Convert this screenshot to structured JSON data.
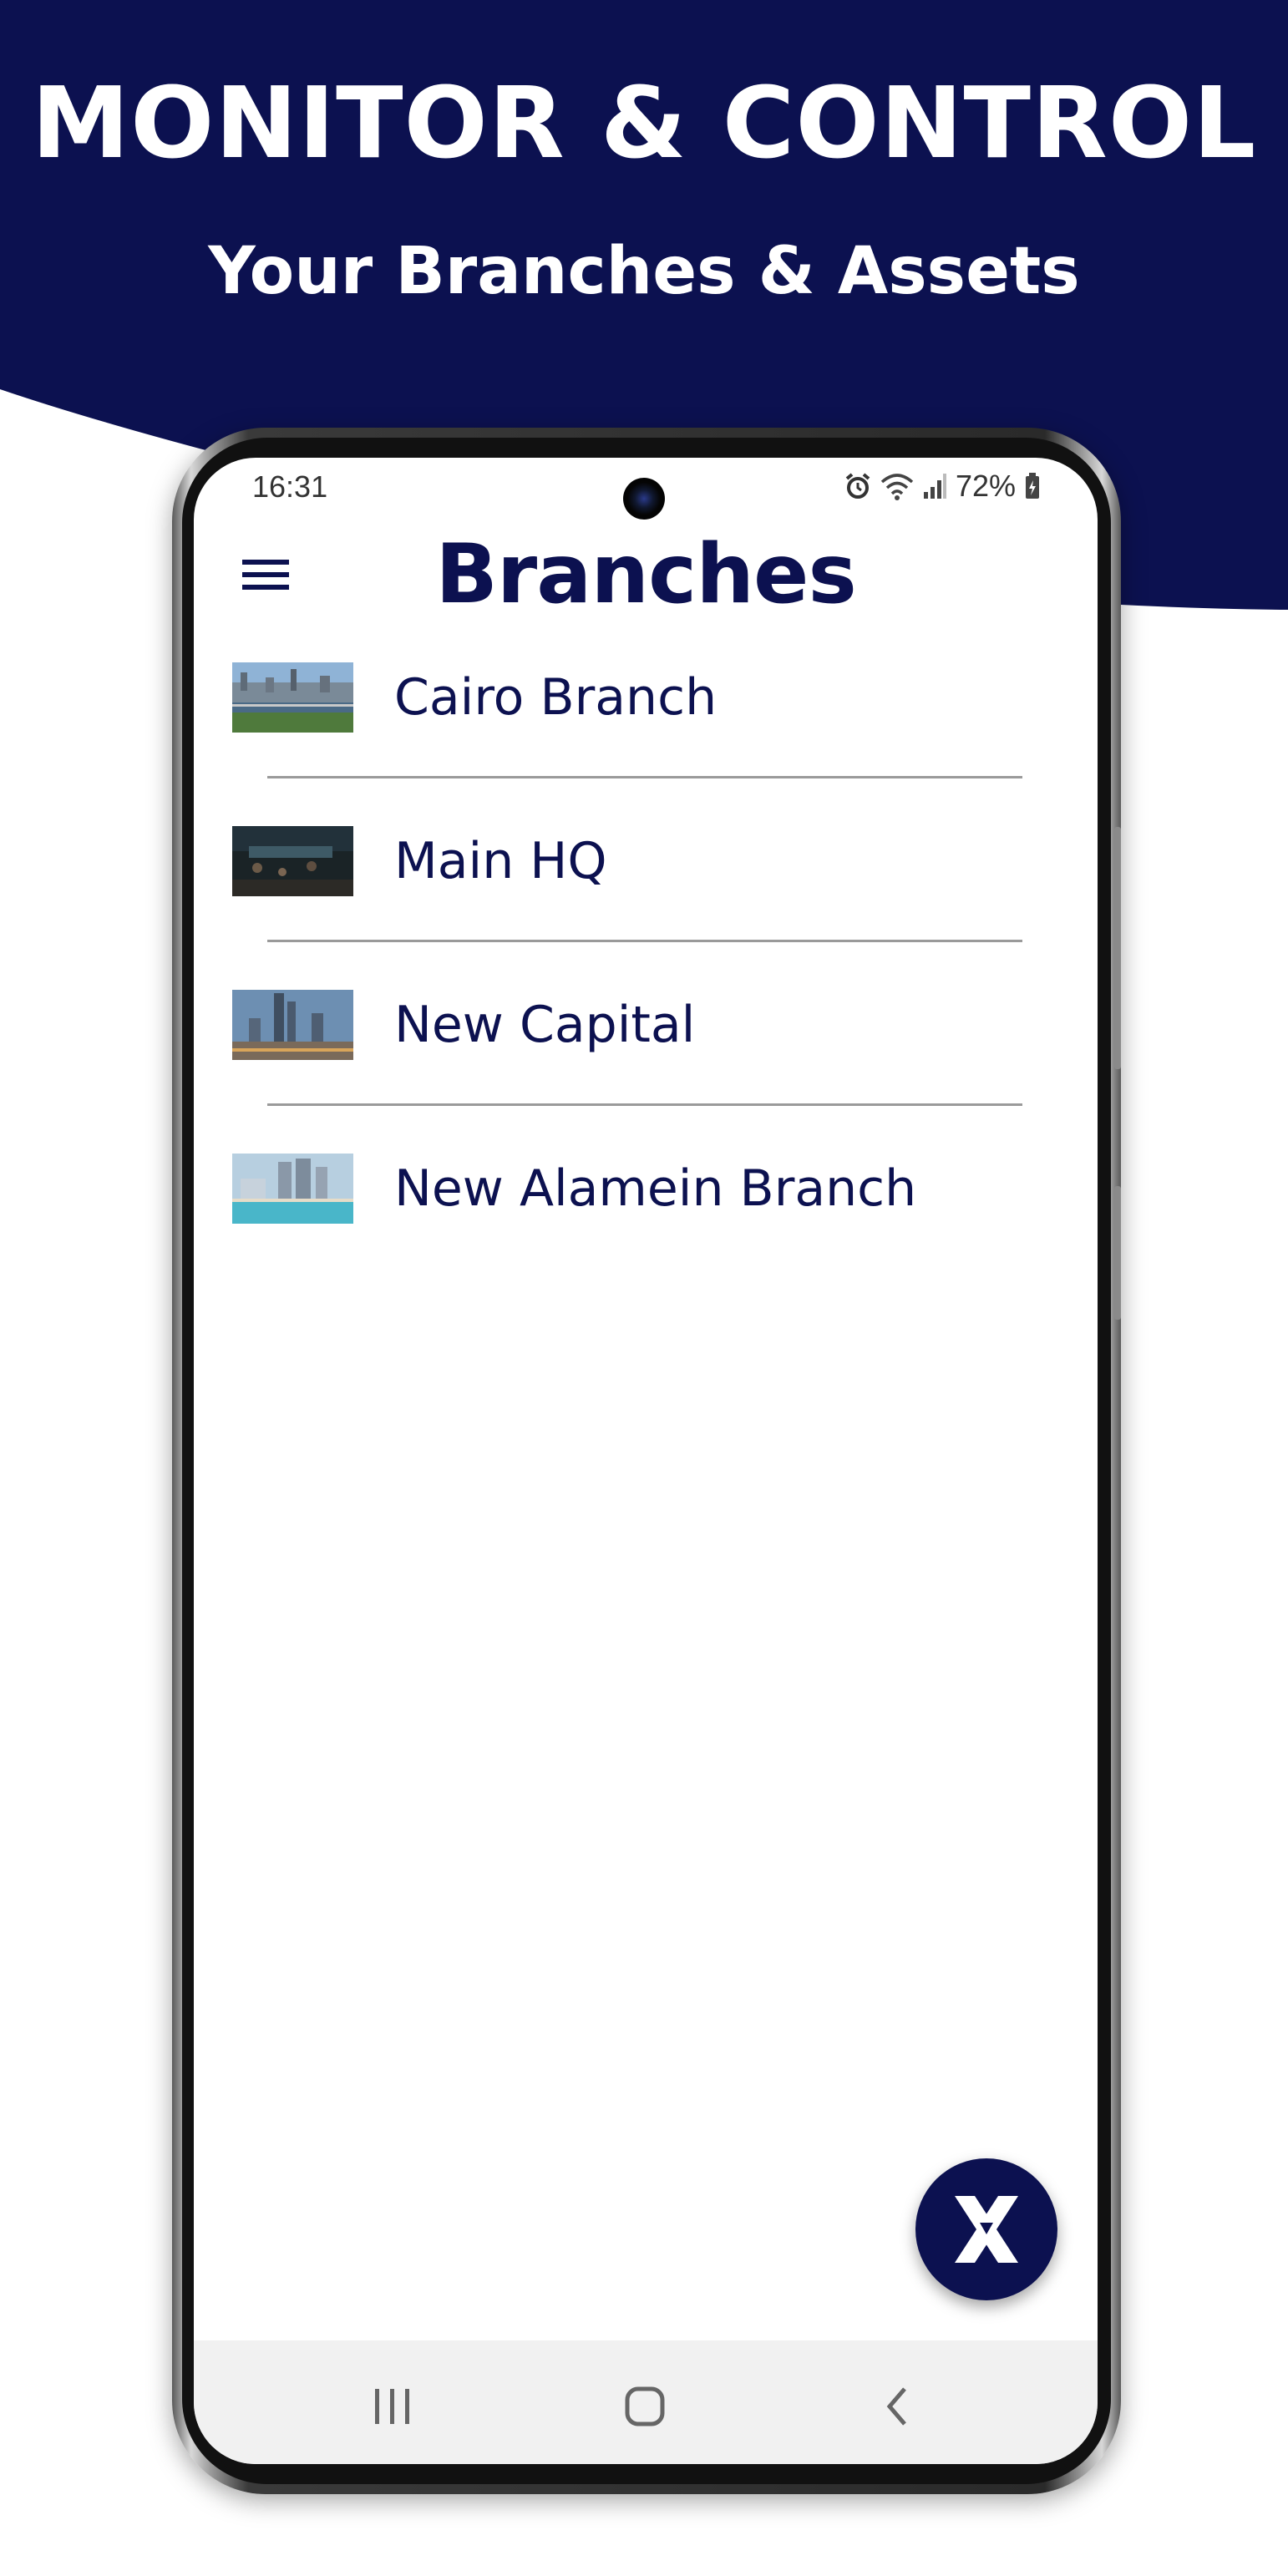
{
  "promo": {
    "title": "MONITOR & CONTROL",
    "subtitle": "Your Branches & Assets"
  },
  "status_bar": {
    "time": "16:31",
    "battery": "72%"
  },
  "app_bar": {
    "title": "Branches",
    "menu_icon": "hamburger-menu-icon"
  },
  "branches": [
    {
      "name": "Cairo Branch",
      "thumbnail": "city-river-skyline-image"
    },
    {
      "name": "Main HQ",
      "thumbnail": "night-office-interior-image"
    },
    {
      "name": "New Capital",
      "thumbnail": "skyscraper-towers-image"
    },
    {
      "name": "New Alamein Branch",
      "thumbnail": "coastal-towers-image"
    }
  ],
  "fab": {
    "icon": "x-logo-icon"
  },
  "nav_bar": {
    "recents_icon": "recents-icon",
    "home_icon": "home-icon",
    "back_icon": "back-icon"
  },
  "colors": {
    "brand_navy": "#0c1150",
    "divider": "#9a9a9a",
    "nav_background": "#f1f1f1"
  }
}
